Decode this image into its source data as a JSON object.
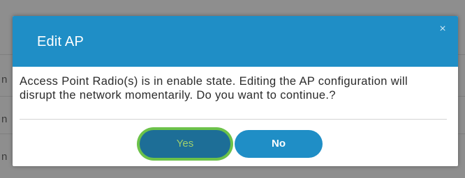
{
  "background": {
    "row_letters": [
      "n",
      "n",
      "n"
    ]
  },
  "dialog": {
    "title": "Edit AP",
    "close_symbol": "×",
    "message": "Access Point Radio(s) is in enable state. Editing the AP configuration will disrupt the network momentarily. Do you want to continue.?",
    "yes_label": "Yes",
    "no_label": "No"
  },
  "colors": {
    "header": "#1f8ec6",
    "yes_button": "#1d6e97",
    "no_button": "#1f8ec6",
    "highlight_ring": "#6cc24a"
  }
}
